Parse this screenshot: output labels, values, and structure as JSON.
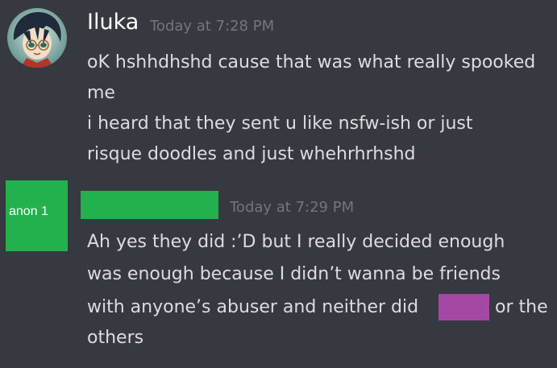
{
  "message1": {
    "username": "Iluka",
    "timestamp": "Today at 7:28 PM",
    "lines": [
      "oK hshhdhshd cause that was what really spooked",
      "me",
      "i heard that they sent u like nsfw-ish or just",
      "risque doodles and just whehrhrhshd"
    ]
  },
  "message2": {
    "avatar_label": "anon 1",
    "timestamp": "Today at 7:29 PM",
    "lines": [
      "Ah yes they did :’D but I really decided enough",
      "was enough because I didn’t wanna be friends",
      "with anyone’s abuser and neither did"
    ],
    "line3_tail": "or the",
    "line4": "others"
  },
  "colors": {
    "background": "#36393f",
    "username": "#ffffff",
    "timestamp": "#72767d",
    "message_text": "#dcddde",
    "redaction_green": "#22b14c",
    "redaction_purple": "#a349a4"
  }
}
